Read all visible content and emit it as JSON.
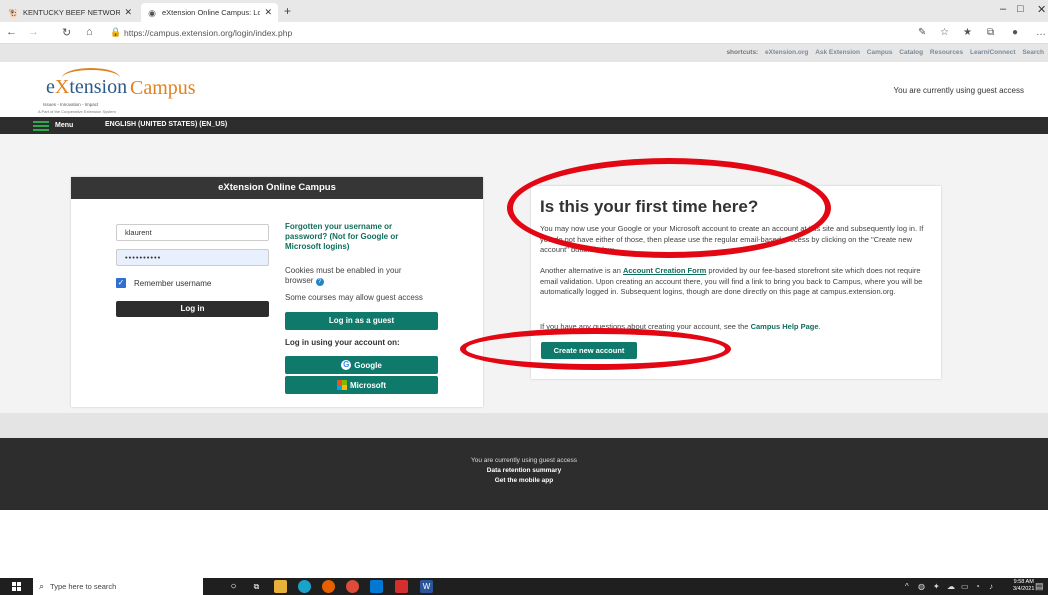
{
  "browser": {
    "tabs": [
      {
        "label": "KENTUCKY BEEF NETWORK - Ho",
        "favicon": "🐮",
        "active": false
      },
      {
        "label": "eXtension Online Campus: Log in",
        "favicon": "◉",
        "active": true
      }
    ],
    "new_tab": "+",
    "window_controls": [
      "–",
      "□",
      "✕"
    ],
    "url_host": "https://campus.extension.org",
    "url_path": "/login/index.php",
    "nav": [
      "←",
      "→",
      "↻",
      "⌂"
    ],
    "toolbar_icons": [
      "edit-icon",
      "favorite-add-icon",
      "favorites-icon",
      "collections-icon",
      "profile-icon",
      "more-icon"
    ]
  },
  "shortcuts": {
    "label": "shortcuts:",
    "links": [
      "eXtension.org",
      "Ask Extension",
      "Campus",
      "Catalog",
      "Resources",
      "Learn/Connect",
      "Search"
    ]
  },
  "header": {
    "logo_ext": "e",
    "logo_x": "X",
    "logo_rest": "tension",
    "logo_campus": "Campus",
    "tagline": "Issues - Innovation - Impact",
    "partof": "A Part of the Cooperative Extension System",
    "guest_access": "You are currently using guest access"
  },
  "menubar": {
    "menu_label": "Menu",
    "language": "ENGLISH (UNITED STATES) (EN_US)"
  },
  "login": {
    "title": "eXtension Online Campus",
    "username_value": "klaurent",
    "password_value": "••••••••••",
    "remember_label": "Remember username",
    "remember_checked": "✓",
    "login_button": "Log in",
    "forgot_link": "Forgotten your username or password? (Not for Google or Microsoft logins)",
    "cookies_note": "Cookies must be enabled in your browser",
    "guest_note": "Some courses may allow guest access",
    "guest_button": "Log in as a guest",
    "login_using": "Log in using your account on:",
    "google_button": "Google",
    "microsoft_button": "Microsoft"
  },
  "info": {
    "title": "Is this your first time here?",
    "p1": "You may now use your Google or your Microsoft account to create an account at this site and subsequently log in. If you do not have either of those, then please use the regular email-based process by clicking on the \"Create new account\" button below.",
    "p2_pre": "Another alternative is an ",
    "p2_link": "Account Creation Form",
    "p2_post": " provided by our fee-based storefront site which does not require email validation. Upon creating an account there, you will find a link to bring you back to Campus, where you will be automatically logged in. Subsequent logins, though are done directly on this page at campus.extension.org.",
    "p3_pre": "If you have any questions about creating your account, see the ",
    "p3_link": "Campus Help Page",
    "p3_post": ".",
    "create_button": "Create new account"
  },
  "footer": {
    "guest": "You are currently using guest access",
    "retention": "Data retention summary",
    "mobile": "Get the mobile app"
  },
  "taskbar": {
    "search_placeholder": "Type here to search",
    "time": "9:58 AM",
    "date": "3/4/2021"
  },
  "colors": {
    "accent_green": "#0f7a6b",
    "link_green": "#0f6e5b",
    "dark_bar": "#2d2d2d",
    "annotation_red": "#e30613",
    "logo_orange": "#e0821f"
  }
}
